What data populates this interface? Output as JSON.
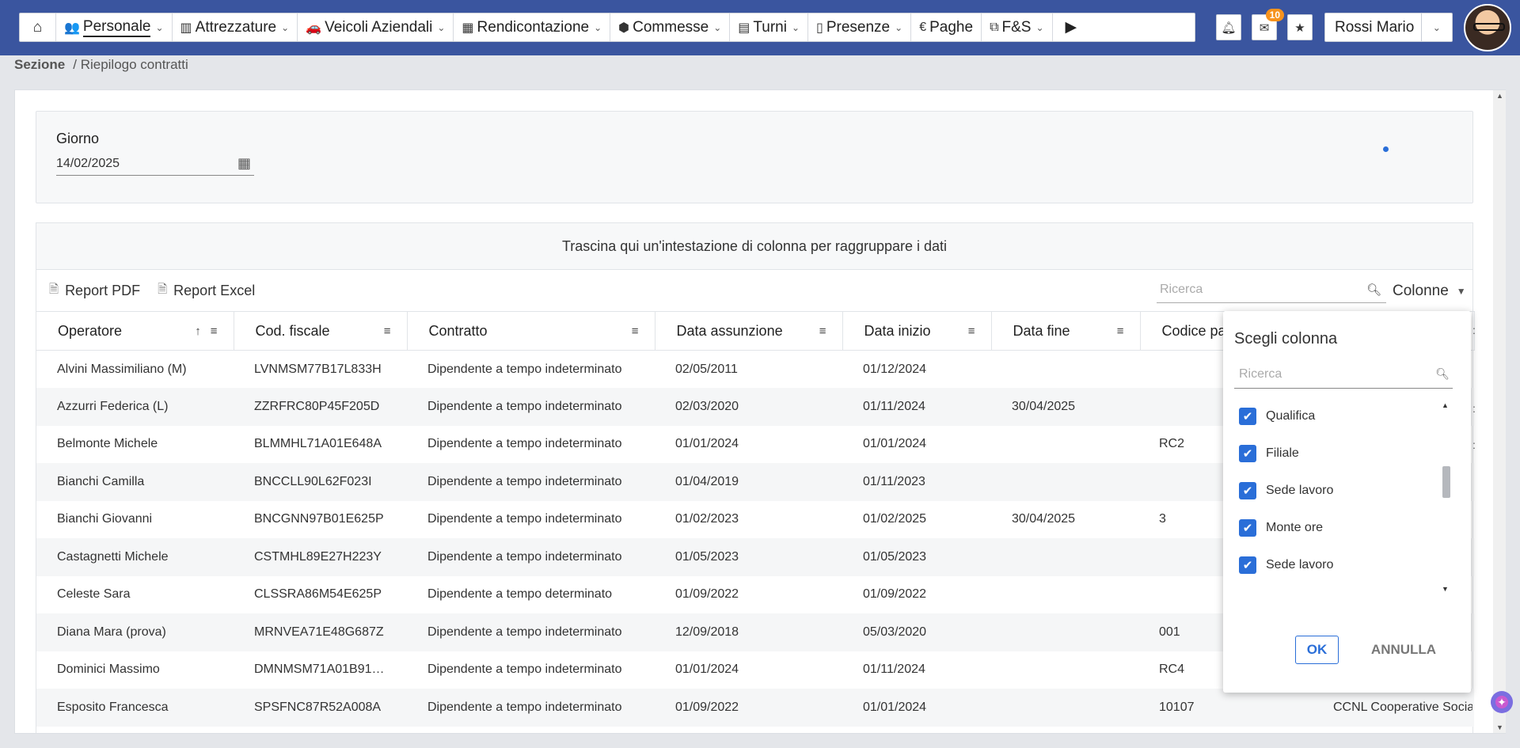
{
  "nav": {
    "home_icon": "home-icon",
    "items": [
      {
        "label": "Personale",
        "icon": "👥",
        "active": true
      },
      {
        "label": "Attrezzature",
        "icon": "▥"
      },
      {
        "label": "Veicoli Aziendali",
        "icon": "🚗"
      },
      {
        "label": "Rendicontazione",
        "icon": "▦"
      },
      {
        "label": "Commesse",
        "icon": "⬢"
      },
      {
        "label": "Turni",
        "icon": "▤"
      },
      {
        "label": "Presenze",
        "icon": "▯"
      },
      {
        "label": "Paghe",
        "icon": "€"
      },
      {
        "label": "F&S",
        "icon": "⧉"
      }
    ],
    "play_icon": "▶",
    "notifications_badge": "10",
    "user_name": "Rossi Mario"
  },
  "breadcrumb": {
    "root": "Sezione",
    "current": "/ Riepilogo contratti"
  },
  "filter": {
    "label": "Giorno",
    "date_value": "14/02/2025"
  },
  "grid": {
    "group_panel_text": "Trascina qui un'intestazione di colonna per raggruppare i dati",
    "report_pdf": "Report PDF",
    "report_excel": "Report Excel",
    "search_placeholder": "Ricerca",
    "columns_button": "Colonne",
    "headers": [
      "Operatore",
      "Cod. fiscale",
      "Contratto",
      "Data assunzione",
      "Data inizio",
      "Data fine",
      "Codice pa"
    ],
    "rows": [
      [
        "Alvini Massimiliano (M)",
        "LVNMSM77B17L833H",
        "Dipendente a tempo indeterminato",
        "02/05/2011",
        "01/12/2024",
        "",
        ""
      ],
      [
        "Azzurri Federica (L)",
        "ZZRFRC80P45F205D",
        "Dipendente a tempo indeterminato",
        "02/03/2020",
        "01/11/2024",
        "30/04/2025",
        ""
      ],
      [
        "Belmonte Michele",
        "BLMMHL71A01E648A",
        "Dipendente a tempo indeterminato",
        "01/01/2024",
        "01/01/2024",
        "",
        "RC2"
      ],
      [
        "Bianchi Camilla",
        "BNCCLL90L62F023I",
        "Dipendente a tempo indeterminato",
        "01/04/2019",
        "01/11/2023",
        "",
        ""
      ],
      [
        "Bianchi Giovanni",
        "BNCGNN97B01E625P",
        "Dipendente a tempo indeterminato",
        "01/02/2023",
        "01/02/2025",
        "30/04/2025",
        "3"
      ],
      [
        "Castagnetti Michele",
        "CSTMHL89E27H223Y",
        "Dipendente a tempo indeterminato",
        "01/05/2023",
        "01/05/2023",
        "",
        ""
      ],
      [
        "Celeste Sara",
        "CLSSRA86M54E625P",
        "Dipendente a tempo determinato",
        "01/09/2022",
        "01/09/2022",
        "",
        ""
      ],
      [
        "Diana Mara (prova)",
        "MRNVEA71E48G687Z",
        "Dipendente a tempo indeterminato",
        "12/09/2018",
        "05/03/2020",
        "",
        "001"
      ],
      [
        "Dominici Massimo",
        "DMNMSM71A01B91…",
        "Dipendente a tempo indeterminato",
        "01/01/2024",
        "01/11/2024",
        "",
        "RC4"
      ],
      [
        "Esposito Francesca",
        "SPSFNC87R52A008A",
        "Dipendente a tempo indeterminato",
        "01/09/2022",
        "01/01/2024",
        "",
        "10107"
      ]
    ],
    "overflow_cell": "CCNL Cooperative Socia"
  },
  "column_chooser": {
    "title": "Scegli colonna",
    "search_placeholder": "Ricerca",
    "items": [
      {
        "label": "Qualifica",
        "checked": true
      },
      {
        "label": "Filiale",
        "checked": true
      },
      {
        "label": "Sede lavoro",
        "checked": true
      },
      {
        "label": "Monte ore",
        "checked": true
      },
      {
        "label": "Sede lavoro",
        "checked": true
      }
    ],
    "ok_label": "OK",
    "cancel_label": "ANNULLA"
  },
  "colors": {
    "topbar": "#3a559f",
    "accent": "#2a6ed8",
    "badge": "#f7931e"
  }
}
